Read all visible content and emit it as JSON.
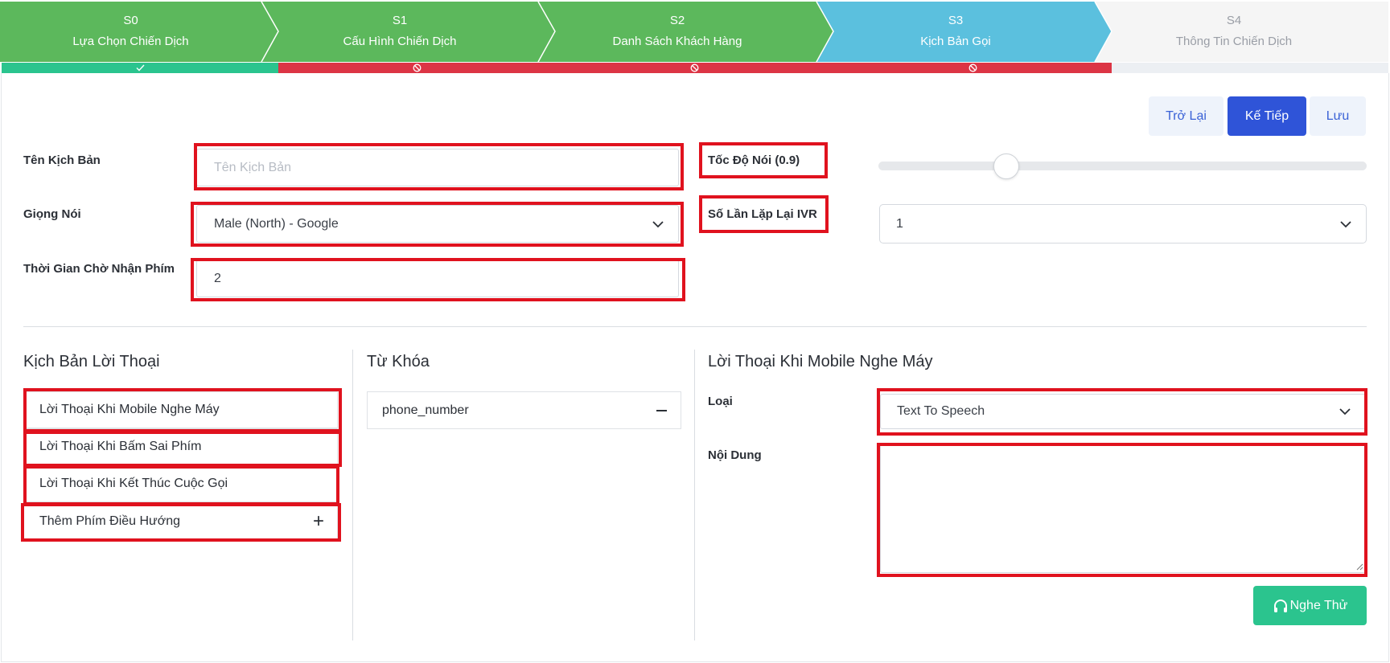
{
  "stepper": {
    "steps": [
      {
        "code": "S0",
        "title": "Lựa Chọn Chiến Dịch",
        "color": "#5cb85c",
        "status": "done"
      },
      {
        "code": "S1",
        "title": "Cấu Hình Chiến Dịch",
        "color": "#5cb85c",
        "status": "blocked"
      },
      {
        "code": "S2",
        "title": "Danh Sách Khách Hàng",
        "color": "#5cb85c",
        "status": "blocked"
      },
      {
        "code": "S3",
        "title": "Kịch Bản Gọi",
        "color": "#5bc0de",
        "status": "blocked"
      },
      {
        "code": "S4",
        "title": "Thông Tin Chiến Dịch",
        "color": "#f5f5f5",
        "status": "none"
      }
    ],
    "status_colors": {
      "done": "#2bc48e",
      "blocked": "#dc3545",
      "none": "#eceff3"
    }
  },
  "actions": {
    "back_label": "Trở Lại",
    "next_label": "Kế Tiếp",
    "save_label": "Lưu"
  },
  "form": {
    "script_name": {
      "label": "Tên Kịch Bản",
      "placeholder": "Tên Kịch Bản",
      "value": ""
    },
    "voice": {
      "label": "Giọng Nói",
      "value": "Male (North) - Google"
    },
    "key_wait_time": {
      "label": "Thời Gian Chờ Nhận Phím",
      "value": "2"
    },
    "speech_rate": {
      "label": "Tốc Độ Nói (0.9)",
      "value": 0.9
    },
    "ivr_repeat": {
      "label": "Số Lần Lặp Lại IVR",
      "value": "1"
    }
  },
  "scripts": {
    "title": "Kịch Bản Lời Thoại",
    "items": [
      "Lời Thoại Khi Mobile Nghe Máy",
      "Lời Thoại Khi Bấm Sai Phím",
      "Lời Thoại Khi Kết Thúc Cuộc Gọi",
      "Thêm Phím Điều Hướng"
    ],
    "add_symbol": "+"
  },
  "keywords": {
    "title": "Từ Khóa",
    "items": [
      "phone_number"
    ]
  },
  "detail": {
    "title": "Lời Thoại Khi Mobile Nghe Máy",
    "type_label": "Loại",
    "type_value": "Text To Speech",
    "content_label": "Nội Dung",
    "content_value": "",
    "listen_label": "Nghe Thử"
  },
  "highlight_color": "#e0121e"
}
